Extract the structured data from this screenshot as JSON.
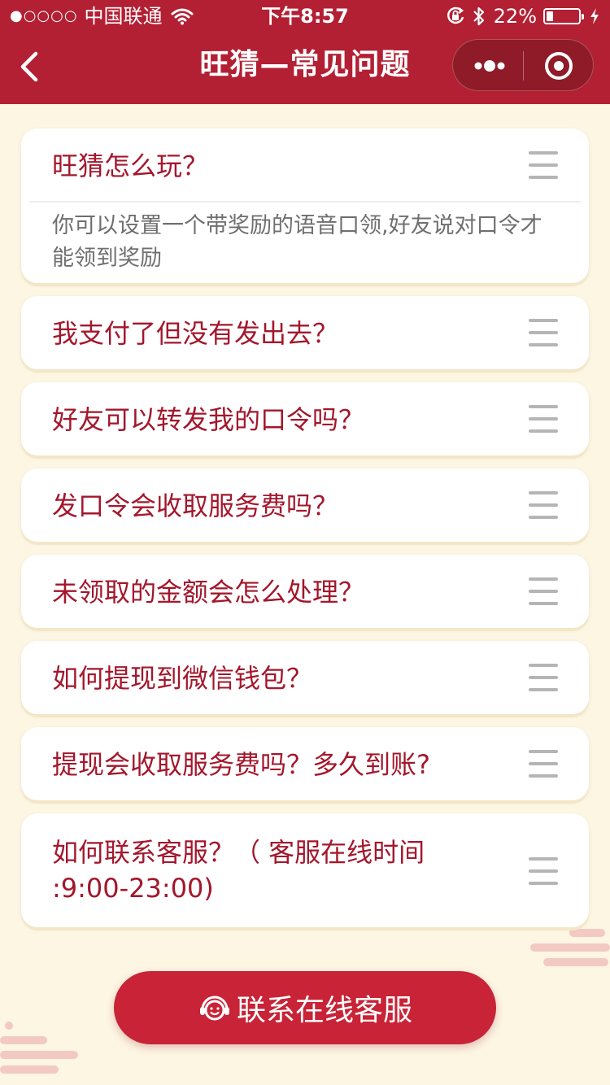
{
  "status_bar": {
    "signal": "●○○○○",
    "carrier": "中国联通",
    "time": "下午8:57",
    "battery_percent": "22%",
    "battery_level": 0.22
  },
  "nav": {
    "title": "旺猜—常见问题"
  },
  "faqs": [
    {
      "question": "旺猜怎么玩？",
      "answer": "你可以设置一个带奖励的语音口领,好友说对口令才能领到奖励",
      "expanded": true
    },
    {
      "question": "我支付了但没有发出去？"
    },
    {
      "question": "好友可以转发我的口令吗？"
    },
    {
      "question": "发口令会收取服务费吗？"
    },
    {
      "question": "未领取的金额会怎么处理？"
    },
    {
      "question": "如何提现到微信钱包？"
    },
    {
      "question": "提现会收取服务费吗？多久到账?"
    },
    {
      "question": "如何联系客服？（ 客服在线时间 :9:00-23:00)"
    }
  ],
  "contact_button": {
    "label": "联系在线客服",
    "icon": "headset-smile-icon"
  },
  "colors": {
    "brand": "#b31f33",
    "question_text": "#a3172c",
    "background": "#fdf6e3",
    "button": "#c82337"
  }
}
